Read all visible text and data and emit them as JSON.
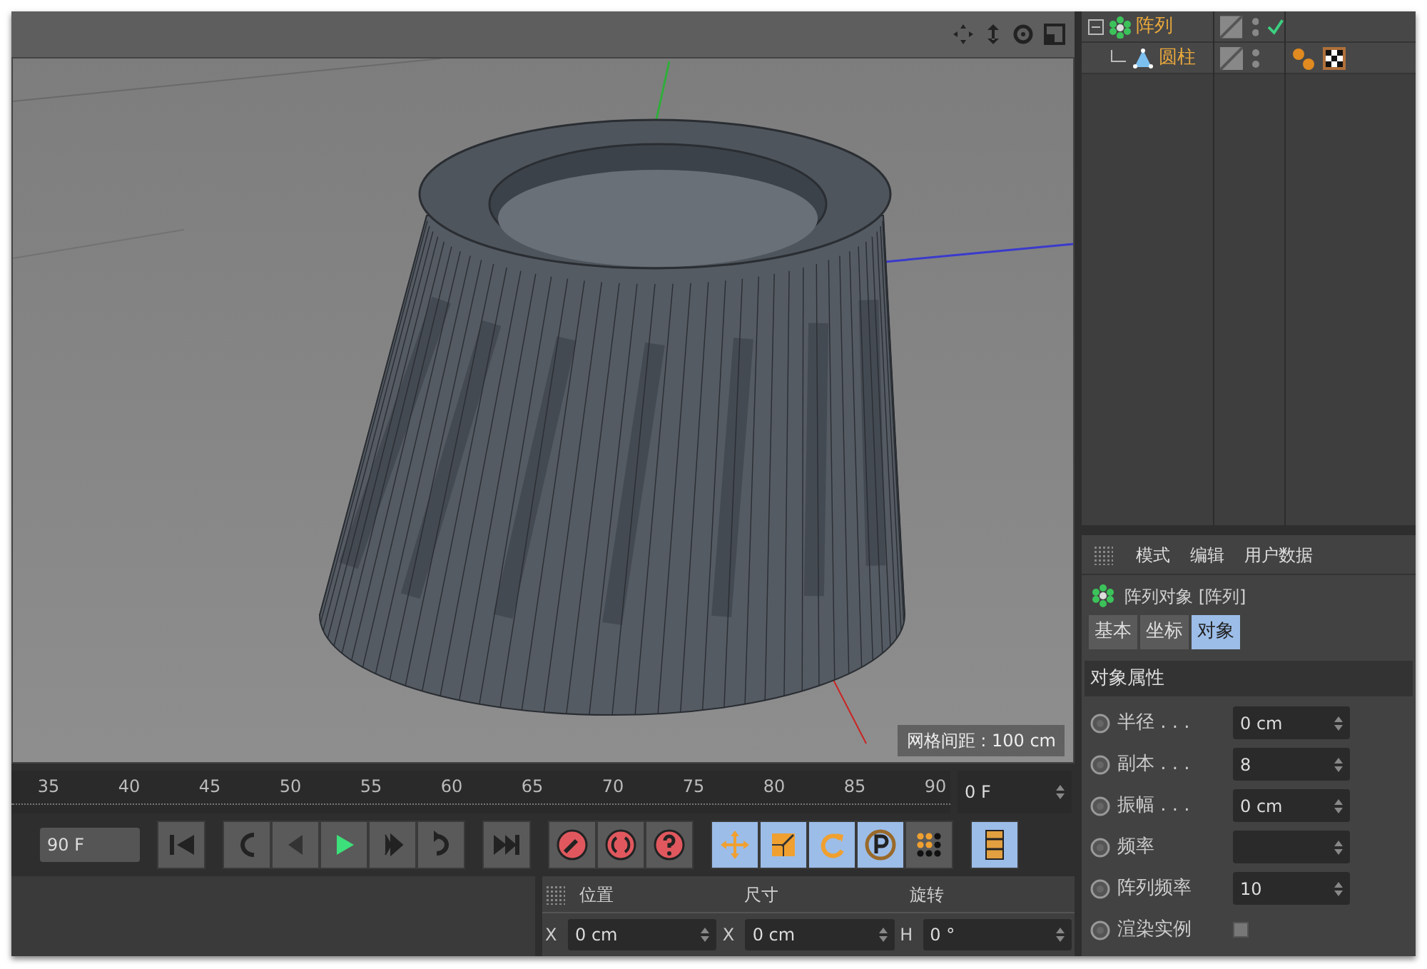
{
  "viewport": {
    "grid_spacing": "网格间距 : 100 cm"
  },
  "object_manager": {
    "objects": [
      {
        "name": "阵列",
        "kind": "array",
        "expanded": true,
        "checked": true,
        "children": [
          {
            "name": "圆柱",
            "kind": "cylinder",
            "checked": false,
            "tags": [
              {
                "kind": "phong"
              },
              {
                "kind": "material"
              }
            ]
          }
        ]
      }
    ]
  },
  "attributes": {
    "menu": [
      "模式",
      "编辑",
      "用户数据"
    ],
    "title": "阵列对象 [阵列]",
    "tabs": [
      {
        "label": "基本",
        "selected": false
      },
      {
        "label": "坐标",
        "selected": false
      },
      {
        "label": "对象",
        "selected": true
      }
    ],
    "section": "对象属性",
    "params": [
      {
        "kind": "number",
        "label": "半径 . . .",
        "value": "0 cm"
      },
      {
        "kind": "number",
        "label": "副本 . . .",
        "value": "8"
      },
      {
        "kind": "number",
        "label": "振幅 . . .",
        "value": "0 cm"
      },
      {
        "kind": "number",
        "label": "频率"
      },
      {
        "kind": "number",
        "label": "阵列频率",
        "value": "10"
      },
      {
        "kind": "checkbox",
        "label": "渲染实例",
        "checked": false
      }
    ]
  },
  "timeline": {
    "ticks": [
      "35",
      "40",
      "45",
      "50",
      "55",
      "60",
      "65",
      "70",
      "75",
      "80",
      "85",
      "90"
    ],
    "current_frame": "0 F"
  },
  "transport": {
    "end_frame": "90 F",
    "tools": [
      {
        "kind": "move",
        "selected": true
      },
      {
        "kind": "scale",
        "selected": true
      },
      {
        "kind": "rotate",
        "selected": true
      },
      {
        "kind": "param",
        "selected": true
      },
      {
        "kind": "points",
        "selected": false
      }
    ]
  },
  "coordinates": {
    "headers": [
      "位置",
      "尺寸",
      "旋转"
    ],
    "fields": [
      {
        "axis": "X",
        "value": "0 cm"
      },
      {
        "axis": "X",
        "value": "0 cm"
      },
      {
        "axis": "H",
        "value": "0 °"
      }
    ]
  }
}
